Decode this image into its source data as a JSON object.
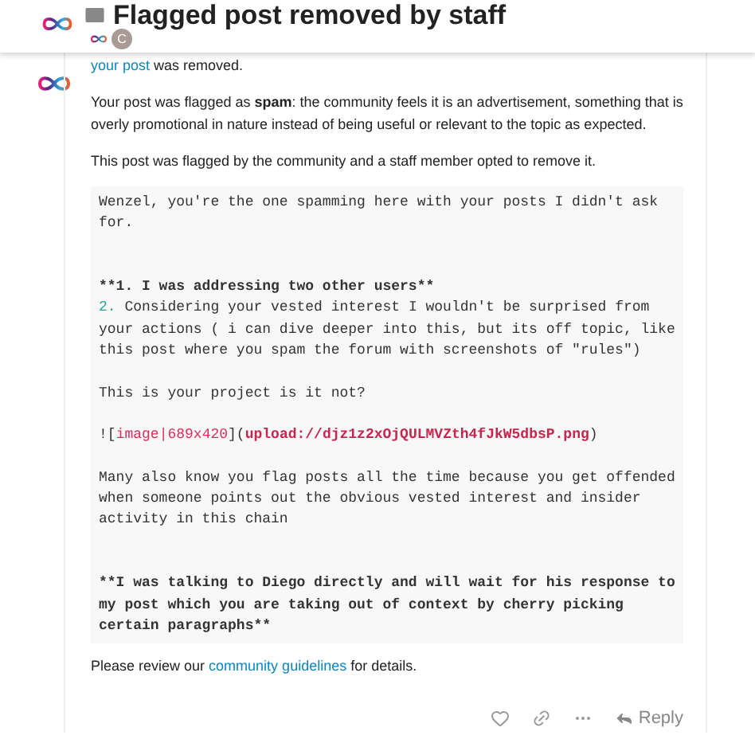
{
  "header": {
    "title": "Flagged post removed by staff",
    "participant_initial": "C"
  },
  "post": {
    "paragraphs": [
      {
        "segments": [
          {
            "kind": "link",
            "text": "your post"
          },
          {
            "kind": "plain",
            "text": " was removed."
          }
        ]
      },
      {
        "segments": [
          {
            "kind": "plain",
            "text": "Your post was flagged as **spam**: the community feels it is an advertisement, something that is overly promotional in nature instead of being useful or relevant to the topic as expected."
          }
        ]
      },
      {
        "segments": [
          {
            "kind": "plain",
            "text": "This post was flagged by the community and a staff member opted to remove it."
          }
        ]
      }
    ],
    "code_lines": [
      {
        "kind": "line",
        "spans": [
          {
            "kind": "plain",
            "text": "Wenzel, you're the one spamming here with your posts I didn't ask"
          }
        ]
      },
      {
        "kind": "line",
        "spans": [
          {
            "kind": "plain",
            "text": "for."
          }
        ]
      },
      {
        "kind": "blank"
      },
      {
        "kind": "blank"
      },
      {
        "kind": "line",
        "spans": [
          {
            "kind": "bold",
            "text": "**1. I was addressing two other users**"
          }
        ]
      },
      {
        "kind": "line",
        "spans": [
          {
            "kind": "number",
            "text": "2."
          },
          {
            "kind": "plain",
            "text": " Considering your vested interest I wouldn't be surprised from"
          }
        ]
      },
      {
        "kind": "line",
        "spans": [
          {
            "kind": "plain",
            "text": "your actions ( i can dive deeper into this, but its off topic, like"
          }
        ]
      },
      {
        "kind": "line",
        "spans": [
          {
            "kind": "plain",
            "text": "this post where you spam the forum with screenshots of \"rules\")"
          }
        ]
      },
      {
        "kind": "blank"
      },
      {
        "kind": "line",
        "spans": [
          {
            "kind": "plain",
            "text": "This is your project is it not?"
          }
        ]
      },
      {
        "kind": "blank"
      },
      {
        "kind": "line",
        "spans": [
          {
            "kind": "plain",
            "text": "!["
          },
          {
            "kind": "link-text",
            "text": "image|689x420"
          },
          {
            "kind": "plain",
            "text": "]("
          },
          {
            "kind": "url",
            "text": "upload://djz1z2xOjQULMVZth4fJkW5dbsP.png"
          },
          {
            "kind": "plain",
            "text": ")"
          }
        ]
      },
      {
        "kind": "blank"
      },
      {
        "kind": "line",
        "spans": [
          {
            "kind": "plain",
            "text": "Many also know you flag posts all the time because you get offended"
          }
        ]
      },
      {
        "kind": "line",
        "spans": [
          {
            "kind": "plain",
            "text": "when someone points out the obvious vested interest and insider"
          }
        ]
      },
      {
        "kind": "line",
        "spans": [
          {
            "kind": "plain",
            "text": "activity in this chain"
          }
        ]
      },
      {
        "kind": "blank"
      },
      {
        "kind": "blank"
      },
      {
        "kind": "line",
        "spans": [
          {
            "kind": "bold",
            "text": "**I was talking to Diego directly and will wait for his response to"
          }
        ]
      },
      {
        "kind": "line",
        "spans": [
          {
            "kind": "bold",
            "text": "my post which you are taking out of context by cherry picking"
          }
        ]
      },
      {
        "kind": "line",
        "spans": [
          {
            "kind": "bold",
            "text": "certain paragraphs**"
          }
        ]
      }
    ],
    "closing": [
      {
        "kind": "plain",
        "text": "Please review our "
      },
      {
        "kind": "link",
        "text": "community guidelines"
      },
      {
        "kind": "plain",
        "text": " for details."
      }
    ],
    "reply_label": "Reply"
  }
}
